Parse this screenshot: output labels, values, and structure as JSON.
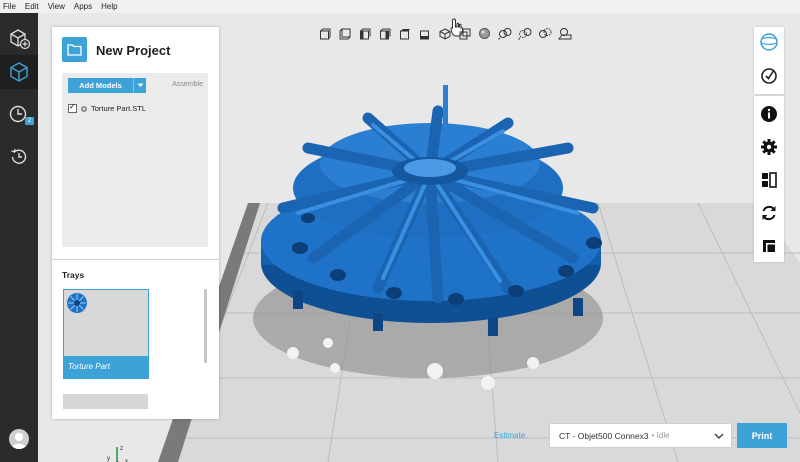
{
  "menu": [
    "File",
    "Edit",
    "View",
    "Apps",
    "Help"
  ],
  "rail": {
    "items": [
      {
        "name": "add-model-icon"
      },
      {
        "name": "3d-cube-icon"
      },
      {
        "name": "clock-queue-icon",
        "badge": "2"
      },
      {
        "name": "history-icon"
      }
    ]
  },
  "view_toolbar": {
    "icons": [
      "front-view-icon",
      "back-view-icon",
      "left-view-icon",
      "right-view-icon",
      "top-view-icon",
      "bottom-view-icon",
      "iso-view-icon",
      "perspective-icon",
      "sphere-icon",
      "zoom-fit-icon",
      "zoom-in-icon",
      "zoom-out-icon",
      "tray-view-icon"
    ]
  },
  "project": {
    "title": "New Project",
    "add_models_label": "Add Models",
    "assemble_label": "Assemble",
    "models": [
      {
        "name": "Torture Part.STL",
        "checked": true
      }
    ]
  },
  "trays": {
    "title": "Trays",
    "items": [
      {
        "label": "Torture Part",
        "selected": true
      }
    ]
  },
  "right_toolbar": {
    "group1": [
      "globe-icon",
      "clock-check-icon"
    ],
    "group2": [
      "info-icon",
      "settings-gear-icon",
      "layout-icon",
      "refresh-icon",
      "corner-icon"
    ]
  },
  "bottom": {
    "estimate_label": "Estimate",
    "printer_name": "CT - Objet500 Connex3",
    "printer_status": "• Idle",
    "print_label": "Print"
  },
  "colors": {
    "accent": "#3da3d6",
    "part": "#1f6fbf",
    "rail": "#2b2b2b"
  }
}
